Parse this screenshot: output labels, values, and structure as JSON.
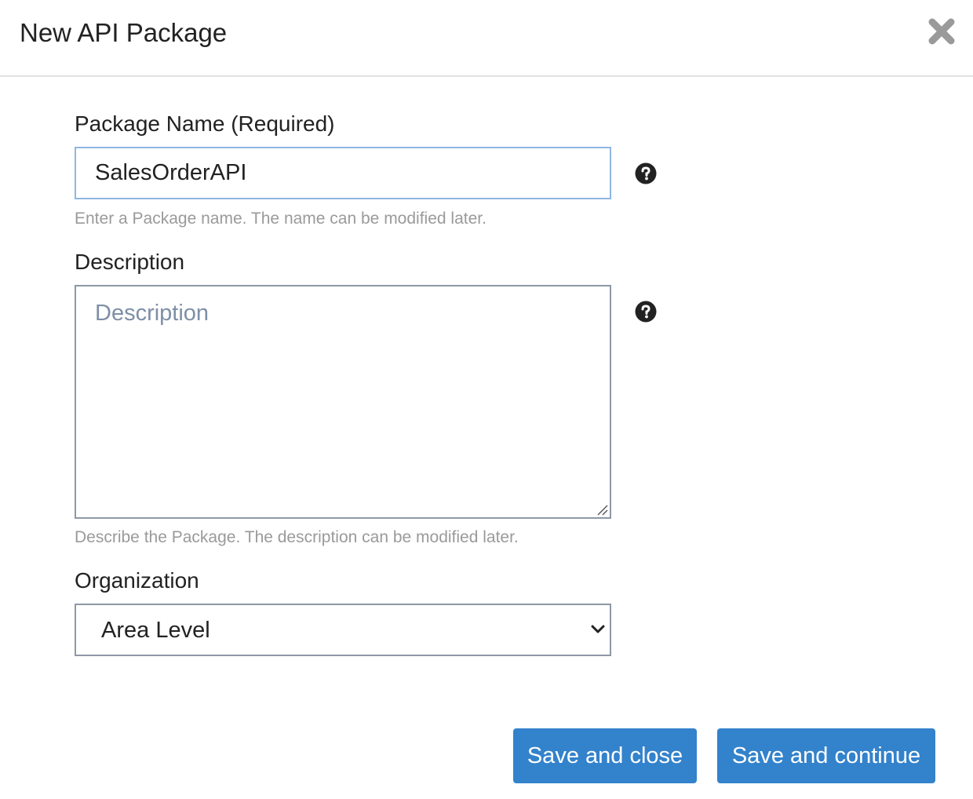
{
  "dialog": {
    "title": "New API Package",
    "close_icon": "close-x-icon"
  },
  "form": {
    "package_name": {
      "label": "Package Name (Required)",
      "value": "SalesOrderAPI",
      "help": "Enter a Package name. The name can be modified later.",
      "help_icon": "question-circle-icon"
    },
    "description": {
      "label": "Description",
      "value": "",
      "placeholder": "Description",
      "help": "Describe the Package. The description can be modified later.",
      "help_icon": "question-circle-icon"
    },
    "organization": {
      "label": "Organization",
      "selected": "Area Level",
      "icon": "chevron-down-icon"
    }
  },
  "actions": {
    "save_close_label": "Save and close",
    "save_continue_label": "Save and continue"
  },
  "colors": {
    "primary_button": "#3382cc",
    "focus_border": "#8fb6e3",
    "help_text": "#9a9a9a",
    "placeholder": "#7e8fa6"
  }
}
